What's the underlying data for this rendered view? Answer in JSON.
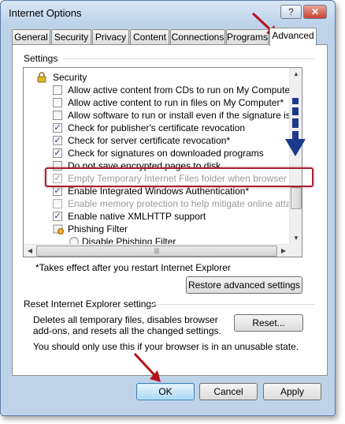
{
  "window": {
    "title": "Internet Options",
    "help_label": "?",
    "close_label": "✕"
  },
  "tabs": [
    {
      "label": "General",
      "active": false
    },
    {
      "label": "Security",
      "active": false
    },
    {
      "label": "Privacy",
      "active": false
    },
    {
      "label": "Content",
      "active": false
    },
    {
      "label": "Connections",
      "active": false
    },
    {
      "label": "Programs",
      "active": false
    },
    {
      "label": "Advanced",
      "active": true
    }
  ],
  "settings": {
    "heading": "Settings",
    "category": "Security",
    "items": [
      {
        "label": "Allow active content from CDs to run on My Computer*",
        "checked": false,
        "disabled": false
      },
      {
        "label": "Allow active content to run in files on My Computer*",
        "checked": false,
        "disabled": false
      },
      {
        "label": "Allow software to run or install even if the signature is inva",
        "checked": false,
        "disabled": false
      },
      {
        "label": "Check for publisher's certificate revocation",
        "checked": true,
        "disabled": false
      },
      {
        "label": "Check for server certificate revocation*",
        "checked": true,
        "disabled": false
      },
      {
        "label": "Check for signatures on downloaded programs",
        "checked": true,
        "disabled": false
      },
      {
        "label": "Do not save encrypted pages to disk",
        "checked": false,
        "disabled": false
      },
      {
        "label": "Empty Temporary Internet Files folder when browser is closed",
        "checked": true,
        "disabled": false
      },
      {
        "label": "Enable Integrated Windows Authentication*",
        "checked": true,
        "disabled": false
      },
      {
        "label": "Enable memory protection to help mitigate online attacks",
        "checked": false,
        "disabled": true
      },
      {
        "label": "Enable native XMLHTTP support",
        "checked": true,
        "disabled": false
      }
    ],
    "subcategory": "Phishing Filter",
    "radio_label": "Disable Phishing Filter",
    "footnote": "*Takes effect after you restart Internet Explorer",
    "restore_button": "Restore advanced settings"
  },
  "reset": {
    "heading": "Reset Internet Explorer settings",
    "description_line1": "Deletes all temporary files, disables browser",
    "description_line2": "add-ons, and resets all the changed settings.",
    "reset_button": "Reset...",
    "warning": "You should only use this if your browser is in an unusable state."
  },
  "footer": {
    "ok": "OK",
    "cancel": "Cancel",
    "apply": "Apply"
  },
  "colors": {
    "annotation_arrow": "#b5121b",
    "highlight_box": "#a52033",
    "scroll_arrow": "#1b3a8c"
  }
}
